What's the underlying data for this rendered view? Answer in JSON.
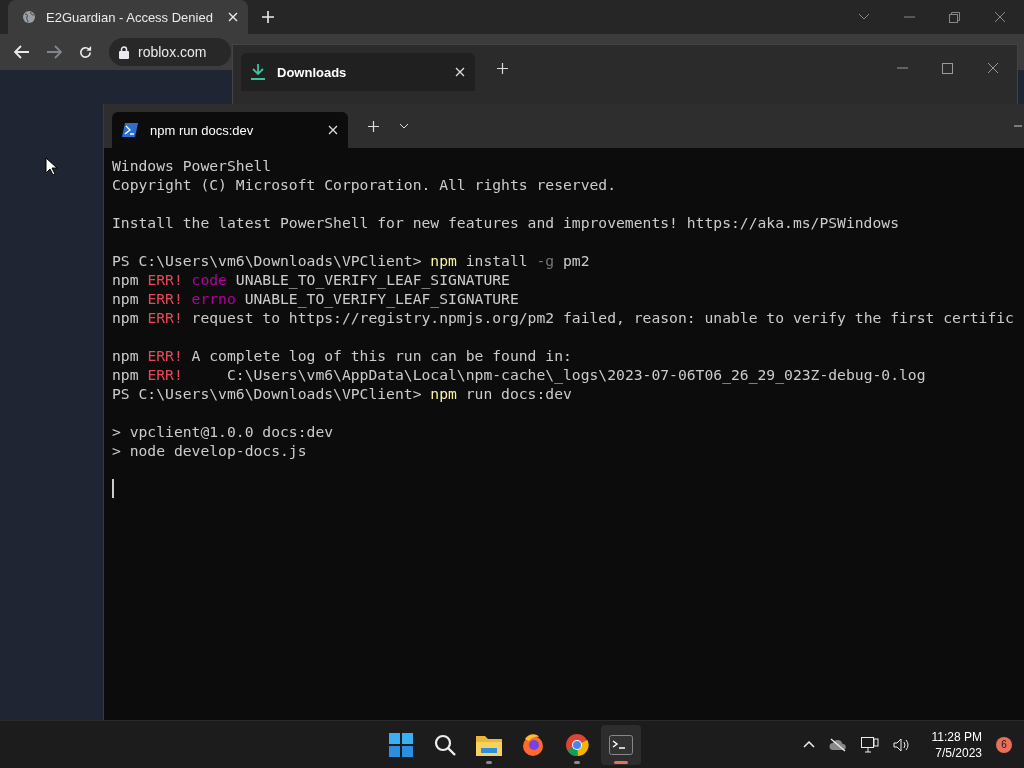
{
  "browser": {
    "tab": {
      "title": "E2Guardian - Access Denied",
      "selected": true
    },
    "address": "roblox.com"
  },
  "downloads_window": {
    "tab": {
      "title": "Downloads",
      "selected": true
    }
  },
  "terminal": {
    "tab": {
      "title": "npm run docs:dev",
      "selected": true
    },
    "blocks": [
      [
        [
          {
            "kind": "plain",
            "text": "Windows PowerShell"
          }
        ],
        [
          {
            "kind": "plain",
            "text": "Copyright (C) Microsoft Corporation. All rights reserved."
          }
        ]
      ],
      [
        [
          {
            "kind": "plain",
            "text": "Install the latest PowerShell for new features and improvements! https://aka.ms/PSWindows"
          }
        ]
      ],
      [
        [
          {
            "kind": "plain",
            "text": "PS C:\\Users\\vm6\\Downloads\\VPClient> "
          },
          {
            "kind": "cmd",
            "text": "npm"
          },
          {
            "kind": "plain",
            "text": " install "
          },
          {
            "kind": "flag",
            "text": "-g"
          },
          {
            "kind": "plain",
            "text": " pm2"
          }
        ],
        [
          {
            "kind": "plain",
            "text": "npm "
          },
          {
            "kind": "err",
            "text": "ERR!"
          },
          {
            "kind": "key",
            "text": " code"
          },
          {
            "kind": "plain",
            "text": " UNABLE_TO_VERIFY_LEAF_SIGNATURE"
          }
        ],
        [
          {
            "kind": "plain",
            "text": "npm "
          },
          {
            "kind": "err",
            "text": "ERR!"
          },
          {
            "kind": "key",
            "text": " errno"
          },
          {
            "kind": "plain",
            "text": " UNABLE_TO_VERIFY_LEAF_SIGNATURE"
          }
        ],
        [
          {
            "kind": "plain",
            "text": "npm "
          },
          {
            "kind": "err",
            "text": "ERR!"
          },
          {
            "kind": "plain",
            "text": " request to https://registry.npmjs.org/pm2 failed, reason: unable to verify the first certific"
          }
        ]
      ],
      [
        [
          {
            "kind": "plain",
            "text": "npm "
          },
          {
            "kind": "err",
            "text": "ERR!"
          },
          {
            "kind": "plain",
            "text": " A complete log of this run can be found in:"
          }
        ],
        [
          {
            "kind": "plain",
            "text": "npm "
          },
          {
            "kind": "err",
            "text": "ERR!"
          },
          {
            "kind": "plain",
            "text": "     C:\\Users\\vm6\\AppData\\Local\\npm-cache\\_logs\\2023-07-06T06_26_29_023Z-debug-0.log"
          }
        ],
        [
          {
            "kind": "plain",
            "text": "PS C:\\Users\\vm6\\Downloads\\VPClient> "
          },
          {
            "kind": "cmd",
            "text": "npm"
          },
          {
            "kind": "plain",
            "text": " run docs:dev"
          }
        ]
      ],
      [
        [
          {
            "kind": "plain",
            "text": "> vpclient@1.0.0 docs:dev"
          }
        ],
        [
          {
            "kind": "plain",
            "text": "> node develop-docs.js"
          }
        ]
      ]
    ]
  },
  "taskbar": {
    "apps": [
      {
        "kind": "start",
        "running": false,
        "selected": false
      },
      {
        "kind": "search",
        "running": false,
        "selected": false
      },
      {
        "kind": "files",
        "running": true,
        "selected": false
      },
      {
        "kind": "firefox",
        "running": false,
        "selected": false
      },
      {
        "kind": "chrome",
        "running": true,
        "selected": false
      },
      {
        "kind": "terminal",
        "running": true,
        "selected": true
      }
    ],
    "time": "11:28 PM",
    "date": "7/5/2023",
    "notifications": "6"
  }
}
